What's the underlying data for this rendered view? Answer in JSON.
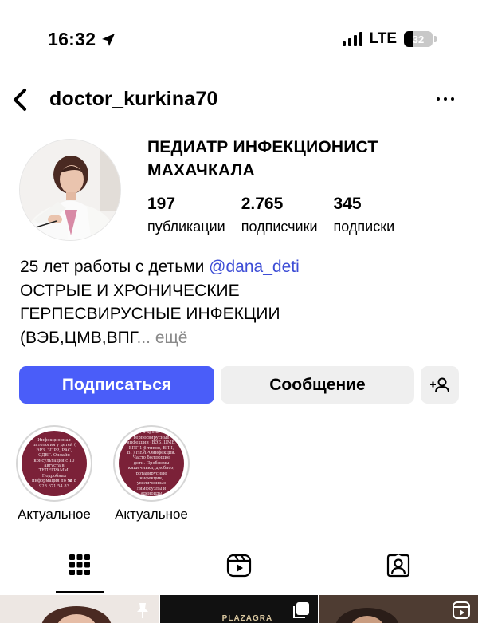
{
  "status_bar": {
    "time": "16:32",
    "network": "LTE",
    "battery": "32",
    "battery_percent": 32,
    "icons": [
      "location-arrow-icon",
      "signal-icon",
      "battery-icon"
    ]
  },
  "header": {
    "username": "doctor_kurkina70",
    "icons": [
      "back-chevron-icon",
      "more-dots-icon"
    ]
  },
  "profile": {
    "display_name": "ПЕДИАТР ИНФЕКЦИОНИСТ МАХАЧКАЛА",
    "stats": [
      {
        "value": "197",
        "label": "публикации"
      },
      {
        "value": "2.765",
        "label": "подписчики"
      },
      {
        "value": "345",
        "label": "подписки"
      }
    ],
    "bio": {
      "line1_text": "25 лет работы с детьми ",
      "mention": "@dana_deti",
      "line2": "ОСТРЫЕ И ХРОНИЧЕСКИЕ",
      "line3": "ГЕРПЕСВИРУСНЫЕ ИНФЕКЦИИ",
      "line4": "(ВЭБ,ЦМВ,ВПГ",
      "ellipsis": "... ",
      "more": "ещё"
    }
  },
  "actions": {
    "follow": "Подписаться",
    "message": "Сообщение",
    "add_user_icon": "add-person-icon"
  },
  "highlights": [
    {
      "label": "Актуальное",
      "cover_text": "Инфекционная патология у детей ( ЭРЗ, ЗПРР, РАС, СДВГ. Онлайн консультации с 10 августа в ТЕЛЕГРАММ. Подробная информация по ☎ 8 928 671 54 83"
    },
    {
      "label": "Актуальное",
      "cover_text": "Семья и хронические герпесвирусные инфекции (ВЭБ, ЦМВ, ВПГ 1-6 типов, ВПЧ, ВГ) НЕЙРОинфекции. Часто болеющие дети. Проблемы кишечника, дисбиоз, ротавирусные инфекции, увеличенные лимфоузлы и аденоиды"
    }
  ],
  "tabs": [
    {
      "name": "grid",
      "icon": "grid-icon",
      "active": true
    },
    {
      "name": "reels",
      "icon": "reels-icon",
      "active": false
    },
    {
      "name": "tagged",
      "icon": "tagged-person-icon",
      "active": false
    }
  ],
  "grid_posts": [
    {
      "icon": "pin-icon"
    },
    {
      "icon": "carousel-icon",
      "text": "PLAZAGRA"
    },
    {
      "icon": "reels-icon"
    }
  ],
  "colors": {
    "accent": "#4a5df9",
    "mention": "#3d4dd6",
    "highlight_cover": "#7b2138",
    "button_secondary": "#efefef"
  }
}
